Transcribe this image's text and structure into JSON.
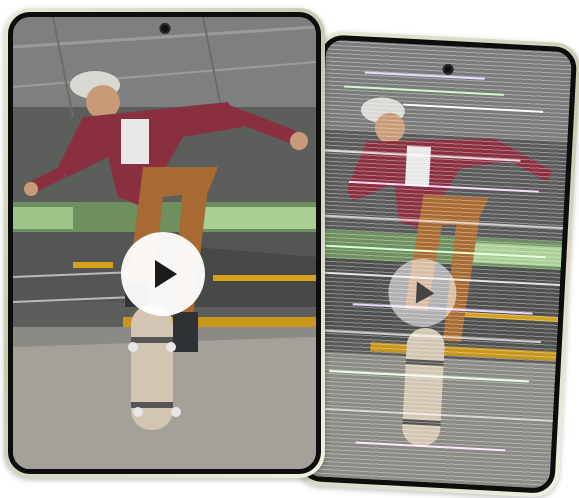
{
  "image": {
    "description_elements": [
      "front-phone",
      "back-phone"
    ]
  },
  "icons": {
    "play": "play-icon"
  }
}
